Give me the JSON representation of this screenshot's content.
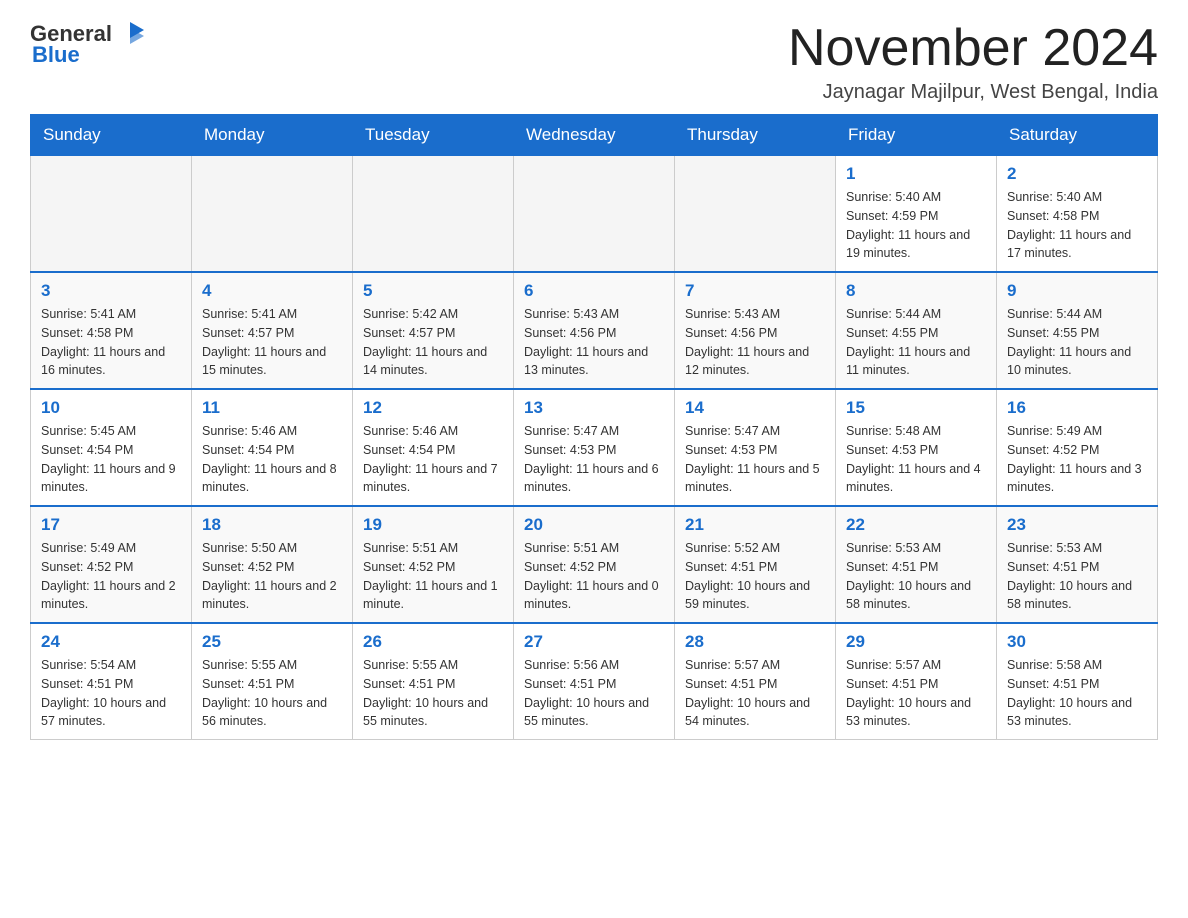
{
  "header": {
    "logo_general": "General",
    "logo_blue": "Blue",
    "month_title": "November 2024",
    "location": "Jaynagar Majilpur, West Bengal, India"
  },
  "days_of_week": [
    "Sunday",
    "Monday",
    "Tuesday",
    "Wednesday",
    "Thursday",
    "Friday",
    "Saturday"
  ],
  "weeks": [
    [
      {
        "day": "",
        "info": ""
      },
      {
        "day": "",
        "info": ""
      },
      {
        "day": "",
        "info": ""
      },
      {
        "day": "",
        "info": ""
      },
      {
        "day": "",
        "info": ""
      },
      {
        "day": "1",
        "info": "Sunrise: 5:40 AM\nSunset: 4:59 PM\nDaylight: 11 hours and 19 minutes."
      },
      {
        "day": "2",
        "info": "Sunrise: 5:40 AM\nSunset: 4:58 PM\nDaylight: 11 hours and 17 minutes."
      }
    ],
    [
      {
        "day": "3",
        "info": "Sunrise: 5:41 AM\nSunset: 4:58 PM\nDaylight: 11 hours and 16 minutes."
      },
      {
        "day": "4",
        "info": "Sunrise: 5:41 AM\nSunset: 4:57 PM\nDaylight: 11 hours and 15 minutes."
      },
      {
        "day": "5",
        "info": "Sunrise: 5:42 AM\nSunset: 4:57 PM\nDaylight: 11 hours and 14 minutes."
      },
      {
        "day": "6",
        "info": "Sunrise: 5:43 AM\nSunset: 4:56 PM\nDaylight: 11 hours and 13 minutes."
      },
      {
        "day": "7",
        "info": "Sunrise: 5:43 AM\nSunset: 4:56 PM\nDaylight: 11 hours and 12 minutes."
      },
      {
        "day": "8",
        "info": "Sunrise: 5:44 AM\nSunset: 4:55 PM\nDaylight: 11 hours and 11 minutes."
      },
      {
        "day": "9",
        "info": "Sunrise: 5:44 AM\nSunset: 4:55 PM\nDaylight: 11 hours and 10 minutes."
      }
    ],
    [
      {
        "day": "10",
        "info": "Sunrise: 5:45 AM\nSunset: 4:54 PM\nDaylight: 11 hours and 9 minutes."
      },
      {
        "day": "11",
        "info": "Sunrise: 5:46 AM\nSunset: 4:54 PM\nDaylight: 11 hours and 8 minutes."
      },
      {
        "day": "12",
        "info": "Sunrise: 5:46 AM\nSunset: 4:54 PM\nDaylight: 11 hours and 7 minutes."
      },
      {
        "day": "13",
        "info": "Sunrise: 5:47 AM\nSunset: 4:53 PM\nDaylight: 11 hours and 6 minutes."
      },
      {
        "day": "14",
        "info": "Sunrise: 5:47 AM\nSunset: 4:53 PM\nDaylight: 11 hours and 5 minutes."
      },
      {
        "day": "15",
        "info": "Sunrise: 5:48 AM\nSunset: 4:53 PM\nDaylight: 11 hours and 4 minutes."
      },
      {
        "day": "16",
        "info": "Sunrise: 5:49 AM\nSunset: 4:52 PM\nDaylight: 11 hours and 3 minutes."
      }
    ],
    [
      {
        "day": "17",
        "info": "Sunrise: 5:49 AM\nSunset: 4:52 PM\nDaylight: 11 hours and 2 minutes."
      },
      {
        "day": "18",
        "info": "Sunrise: 5:50 AM\nSunset: 4:52 PM\nDaylight: 11 hours and 2 minutes."
      },
      {
        "day": "19",
        "info": "Sunrise: 5:51 AM\nSunset: 4:52 PM\nDaylight: 11 hours and 1 minute."
      },
      {
        "day": "20",
        "info": "Sunrise: 5:51 AM\nSunset: 4:52 PM\nDaylight: 11 hours and 0 minutes."
      },
      {
        "day": "21",
        "info": "Sunrise: 5:52 AM\nSunset: 4:51 PM\nDaylight: 10 hours and 59 minutes."
      },
      {
        "day": "22",
        "info": "Sunrise: 5:53 AM\nSunset: 4:51 PM\nDaylight: 10 hours and 58 minutes."
      },
      {
        "day": "23",
        "info": "Sunrise: 5:53 AM\nSunset: 4:51 PM\nDaylight: 10 hours and 58 minutes."
      }
    ],
    [
      {
        "day": "24",
        "info": "Sunrise: 5:54 AM\nSunset: 4:51 PM\nDaylight: 10 hours and 57 minutes."
      },
      {
        "day": "25",
        "info": "Sunrise: 5:55 AM\nSunset: 4:51 PM\nDaylight: 10 hours and 56 minutes."
      },
      {
        "day": "26",
        "info": "Sunrise: 5:55 AM\nSunset: 4:51 PM\nDaylight: 10 hours and 55 minutes."
      },
      {
        "day": "27",
        "info": "Sunrise: 5:56 AM\nSunset: 4:51 PM\nDaylight: 10 hours and 55 minutes."
      },
      {
        "day": "28",
        "info": "Sunrise: 5:57 AM\nSunset: 4:51 PM\nDaylight: 10 hours and 54 minutes."
      },
      {
        "day": "29",
        "info": "Sunrise: 5:57 AM\nSunset: 4:51 PM\nDaylight: 10 hours and 53 minutes."
      },
      {
        "day": "30",
        "info": "Sunrise: 5:58 AM\nSunset: 4:51 PM\nDaylight: 10 hours and 53 minutes."
      }
    ]
  ]
}
